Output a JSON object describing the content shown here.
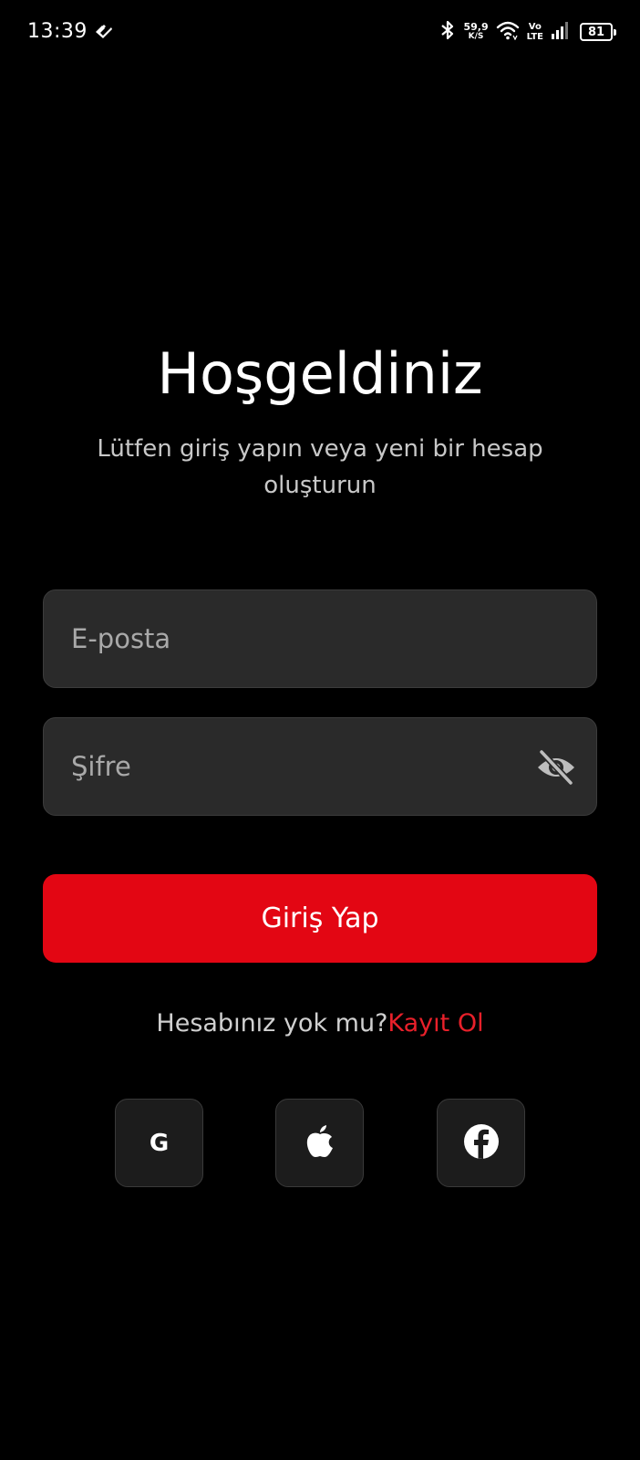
{
  "status_bar": {
    "time": "13:39",
    "net_speed_value": "59,9",
    "net_speed_unit": "K/S",
    "volte_top": "Vo",
    "volte_bottom": "LTE",
    "battery_level": "81",
    "icons": [
      "app-notification-icon",
      "bluetooth-icon",
      "wifi-icon",
      "signal-icon",
      "battery-icon"
    ]
  },
  "welcome": {
    "title": "Hoşgeldiniz",
    "subtitle": "Lütfen giriş yapın veya yeni bir hesap oluşturun"
  },
  "form": {
    "email_placeholder": "E-posta",
    "email_value": "",
    "password_placeholder": "Şifre",
    "password_value": "",
    "password_visibility_icon": "eye-off-icon",
    "login_label": "Giriş Yap"
  },
  "register": {
    "prompt": "Hesabınız yok mu?",
    "link_label": "Kayıt Ol"
  },
  "social": {
    "google_label": "G",
    "icons": [
      "google-icon",
      "apple-icon",
      "facebook-icon"
    ]
  },
  "colors": {
    "background": "#000000",
    "field_background": "#2a2a2a",
    "accent": "#e30613",
    "link": "#e8202a",
    "placeholder": "#a9a9a9"
  }
}
